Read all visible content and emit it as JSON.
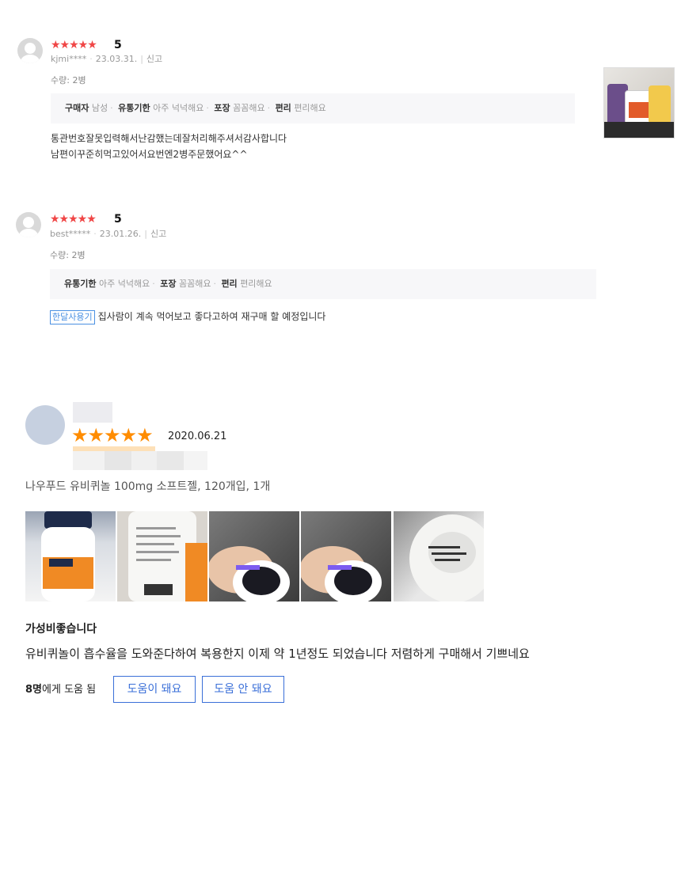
{
  "reviews_top": [
    {
      "stars": "★★★★★",
      "score": "5",
      "user": "kjmi****",
      "date": "23.03.31.",
      "report": "신고",
      "quantity": "수량: 2병",
      "attributes": [
        {
          "key": "구매자",
          "value": "남성"
        },
        {
          "key": "유통기한",
          "value": "아주 넉넉해요"
        },
        {
          "key": "포장",
          "value": "꼼꼼해요"
        },
        {
          "key": "편리",
          "value": "편리해요"
        }
      ],
      "text_lines": [
        "통관번호잘못입력해서난감했는데잘처리해주셔서감사합니다",
        "남편이꾸준히먹고있어서요번엔2병주문했어요^^"
      ]
    },
    {
      "stars": "★★★★★",
      "score": "5",
      "user": "best*****",
      "date": "23.01.26.",
      "report": "신고",
      "quantity": "수량: 2병",
      "attributes": [
        {
          "key": "유통기한",
          "value": "아주 넉넉해요"
        },
        {
          "key": "포장",
          "value": "꼼꼼해요"
        },
        {
          "key": "편리",
          "value": "편리해요"
        }
      ],
      "tag": "한달사용기",
      "text": "집사람이 계속 먹어보고 좋다고하여 재구매 할 예정입니다"
    }
  ],
  "review_detail": {
    "stars": "★★★★★",
    "date": "2020.06.21",
    "product": "나우푸드 유비퀴놀 100mg 소프트젤, 120개입, 1개",
    "title": "가성비좋습니다",
    "body": "유비퀴놀이 흡수율을 도와준다하여 복용한지 이제 약 1년정도 되었습니다 저렴하게 구매해서 기쁘네요",
    "helpful_count": "8명",
    "helpful_suffix": "에게 도움 됨",
    "helpful_yes": "도움이 돼요",
    "helpful_no": "도움 안 돼요"
  },
  "colors": {
    "star_red": "#f04646",
    "star_orange": "#ff8c00",
    "button_blue": "#3a6fd8",
    "tag_blue": "#4a90e2"
  }
}
